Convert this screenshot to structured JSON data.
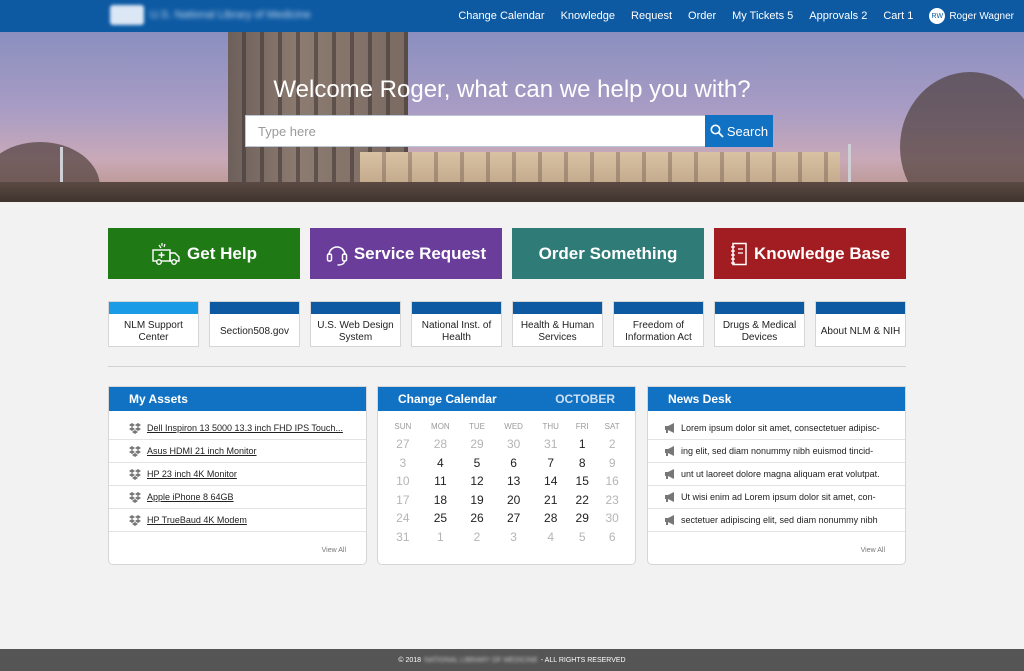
{
  "nav": {
    "links": [
      "Change Calendar",
      "Knowledge",
      "Request",
      "Order",
      "My Tickets 5",
      "Approvals 2",
      "Cart 1"
    ],
    "user_initials": "RW",
    "user_name": "Roger Wagner"
  },
  "hero": {
    "title": "Welcome Roger, what can we help you with?",
    "search_placeholder": "Type here",
    "search_button": "Search"
  },
  "tiles": [
    {
      "label": "Get Help",
      "color": "#1f7a15",
      "icon": "ambulance-icon"
    },
    {
      "label": "Service Request",
      "color": "#6a3d9a",
      "icon": "headset-icon"
    },
    {
      "label": "Order Something",
      "color": "#2f7b77",
      "icon": ""
    },
    {
      "label": "Knowledge Base",
      "color": "#a11d22",
      "icon": "notebook-icon"
    }
  ],
  "links": [
    "NLM Support Center",
    "Section508.gov",
    "U.S. Web Design System",
    "National Inst. of Health",
    "Health & Human Services",
    "Freedom of Information Act",
    "Drugs & Medical Devices",
    "About NLM & NIH"
  ],
  "assets": {
    "title": "My Assets",
    "items": [
      "Dell Inspiron 13 5000 13.3 inch FHD IPS Touch...",
      "Asus HDMI 21 inch Monitor",
      "HP 23 inch 4K Monitor",
      "Apple iPhone 8 64GB",
      "HP TrueBaud 4K Modem"
    ],
    "view_all": "View All"
  },
  "calendar": {
    "title": "Change Calendar",
    "month": "OCTOBER",
    "weekdays": [
      "SUN",
      "MON",
      "TUE",
      "WED",
      "THU",
      "FRI",
      "SAT"
    ],
    "weeks": [
      [
        "27",
        "28",
        "29",
        "30",
        "31",
        "1",
        "2"
      ],
      [
        "3",
        "4",
        "5",
        "6",
        "7",
        "8",
        "9"
      ],
      [
        "10",
        "11",
        "12",
        "13",
        "14",
        "15",
        "16"
      ],
      [
        "17",
        "18",
        "19",
        "20",
        "21",
        "22",
        "23"
      ],
      [
        "24",
        "25",
        "26",
        "27",
        "28",
        "29",
        "30"
      ],
      [
        "31",
        "1",
        "2",
        "3",
        "4",
        "5",
        "6"
      ]
    ]
  },
  "news": {
    "title": "News Desk",
    "items": [
      "Lorem ipsum dolor sit amet, consectetuer adipisc-",
      "ing elit, sed diam nonummy nibh euismod tincid-",
      "unt ut laoreet dolore magna aliquam erat volutpat.",
      "Ut wisi enim ad Lorem ipsum dolor sit amet, con-",
      "sectetuer adipiscing elit, sed diam nonummy nibh"
    ],
    "view_all": "View All"
  },
  "footer": {
    "copyright": "© 2018",
    "org": "NATIONAL LIBRARY OF MEDICINE",
    "rights": "- ALL RIGHTS RESERVED"
  }
}
